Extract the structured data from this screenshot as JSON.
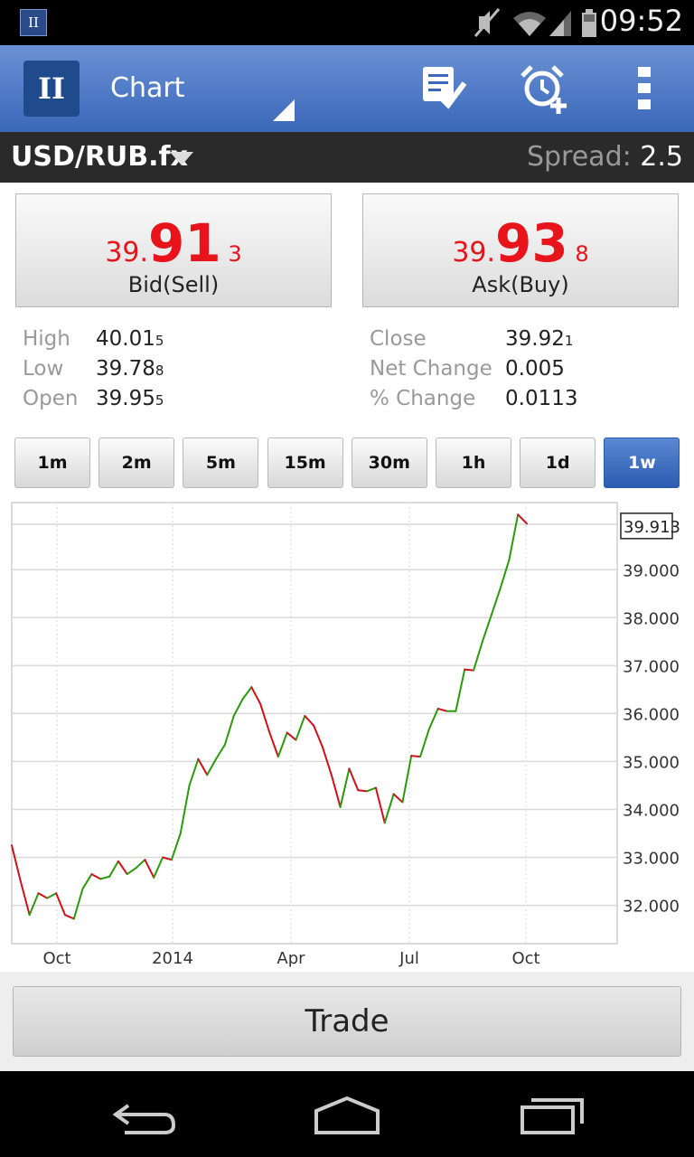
{
  "status_bar": {
    "app_badge": "II",
    "time": "09:52",
    "icons": [
      "mute-icon",
      "wifi-icon",
      "signal-icon",
      "battery-icon"
    ]
  },
  "action_bar": {
    "logo_text": "II",
    "title": "Chart",
    "actions": [
      "order-list-icon",
      "alarm-add-icon",
      "overflow-menu-icon"
    ],
    "color": "#3a67b8"
  },
  "symbol_bar": {
    "symbol": "USD/RUB.fx",
    "spread_label": "Spread:",
    "spread_value": "2.5"
  },
  "quotes": {
    "bid": {
      "prefix": "39.",
      "big": "91",
      "sub": "3",
      "label": "Bid(Sell)"
    },
    "ask": {
      "prefix": "39.",
      "big": "93",
      "sub": "8",
      "label": "Ask(Buy)"
    },
    "price_color": "#e8141b"
  },
  "stats_left": [
    {
      "label": "High",
      "value": "40.01",
      "sub": "5"
    },
    {
      "label": "Low",
      "value": "39.78",
      "sub": "8"
    },
    {
      "label": "Open",
      "value": "39.95",
      "sub": "5"
    }
  ],
  "stats_right": [
    {
      "label": "Close",
      "value": "39.92",
      "sub": "1"
    },
    {
      "label": "Net Change",
      "value": "0.005",
      "sub": ""
    },
    {
      "label": "% Change",
      "value": "0.0113",
      "sub": ""
    }
  ],
  "timeframes": [
    {
      "label": "1m",
      "active": false
    },
    {
      "label": "2m",
      "active": false
    },
    {
      "label": "5m",
      "active": false
    },
    {
      "label": "15m",
      "active": false
    },
    {
      "label": "30m",
      "active": false
    },
    {
      "label": "1h",
      "active": false
    },
    {
      "label": "1d",
      "active": false
    },
    {
      "label": "1w",
      "active": true
    }
  ],
  "chart_data": {
    "type": "line",
    "x_tick_labels": [
      "Oct",
      "2014",
      "Apr",
      "Jul",
      "Oct"
    ],
    "y_tick_labels": [
      "39.000",
      "38.000",
      "37.000",
      "36.000",
      "35.000",
      "34.000",
      "33.000",
      "32.000"
    ],
    "y_ticks": [
      39,
      38,
      37,
      36,
      35,
      34,
      33,
      32
    ],
    "ylim": [
      31.2,
      40.4
    ],
    "last_price_label": "39.913",
    "last_price": 39.913,
    "up_color": "#2a9a0a",
    "down_color": "#d0101a",
    "grid": true,
    "values": [
      33.25,
      32.5,
      31.8,
      32.25,
      32.15,
      32.25,
      31.8,
      31.72,
      32.35,
      32.65,
      32.55,
      32.6,
      32.92,
      32.65,
      32.78,
      32.95,
      32.58,
      33.0,
      32.95,
      33.5,
      34.5,
      35.05,
      34.72,
      35.05,
      35.35,
      35.95,
      36.3,
      36.55,
      36.2,
      35.62,
      35.1,
      35.6,
      35.45,
      35.95,
      35.75,
      35.3,
      34.72,
      34.05,
      34.85,
      34.4,
      34.38,
      34.45,
      33.72,
      34.32,
      34.15,
      35.12,
      35.1,
      35.68,
      36.1,
      36.05,
      36.05,
      36.92,
      36.9,
      37.5,
      38.05,
      38.6,
      39.2,
      40.15,
      39.96
    ]
  },
  "trade_button": {
    "label": "Trade"
  },
  "nav_bar": {
    "icons": [
      "back-icon",
      "home-icon",
      "recent-apps-icon"
    ]
  }
}
